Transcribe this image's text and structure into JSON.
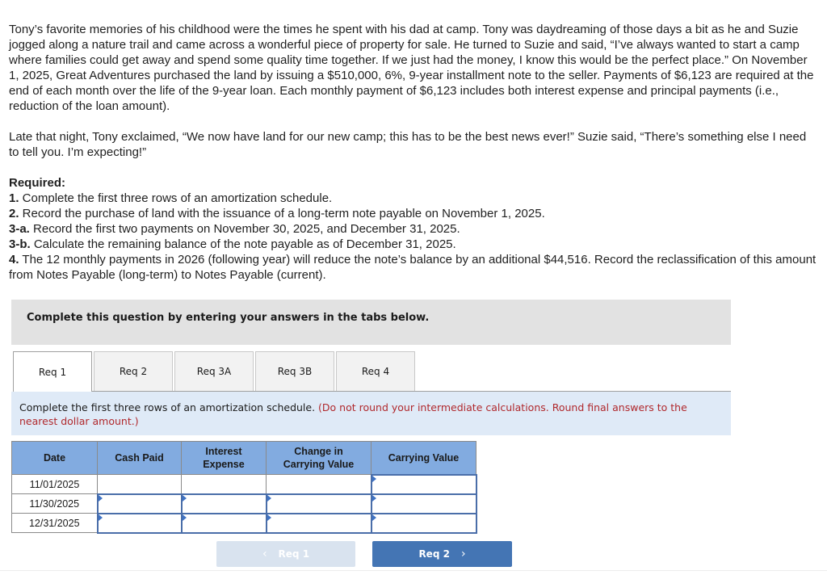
{
  "problem": {
    "paragraph1": "Tony’s favorite memories of his childhood were the times he spent with his dad at camp. Tony was daydreaming of those days a bit as he and Suzie jogged along a nature trail and came across a wonderful piece of property for sale. He turned to Suzie and said, “I’ve always wanted to start a camp where families could get away and spend some quality time together. If we just had the money, I know this would be the perfect place.” On November 1, 2025, Great Adventures purchased the land by issuing a $510,000, 6%, 9-year installment note to the seller. Payments of $6,123 are required at the end of each month over the life of the 9-year loan. Each monthly payment of $6,123 includes both interest expense and principal payments (i.e., reduction of the loan amount).",
    "paragraph2": "Late that night, Tony exclaimed, “We now have land for our new camp; this has to be the best news ever!” Suzie said, “There’s something else I need to tell you. I’m expecting!”",
    "required_title": "Required:",
    "requirements": [
      {
        "num": "1.",
        "text": " Complete the first three rows of an amortization schedule."
      },
      {
        "num": "2.",
        "text": " Record the purchase of land with the issuance of a long-term note payable on November 1, 2025."
      },
      {
        "num": "3-a.",
        "text": " Record the first two payments on November 30, 2025, and December 31, 2025."
      },
      {
        "num": "3-b.",
        "text": " Calculate the remaining balance of the note payable as of December 31, 2025."
      },
      {
        "num": "4.",
        "text": " The 12 monthly payments in 2026 (following year) will reduce the note’s balance by an additional $44,516. Record the reclassification of this amount from Notes Payable (long-term) to Notes Payable (current)."
      }
    ]
  },
  "instructions": "Complete this question by entering your answers in the tabs below.",
  "tabs": [
    {
      "label": "Req 1",
      "active": true
    },
    {
      "label": "Req 2",
      "active": false
    },
    {
      "label": "Req 3A",
      "active": false
    },
    {
      "label": "Req 3B",
      "active": false
    },
    {
      "label": "Req 4",
      "active": false
    }
  ],
  "prompt": {
    "text": "Complete the first three rows of an amortization schedule. ",
    "note": "(Do not round your intermediate calculations. Round final answers to the nearest dollar amount.)"
  },
  "table": {
    "headers": [
      "Date",
      "Cash Paid",
      "Interest Expense",
      "Change in Carrying Value",
      "Carrying Value"
    ],
    "rows": [
      {
        "date": "11/01/2025",
        "cash_paid": "",
        "interest_expense": "",
        "change": "",
        "carrying_value": ""
      },
      {
        "date": "11/30/2025",
        "cash_paid": "",
        "interest_expense": "",
        "change": "",
        "carrying_value": ""
      },
      {
        "date": "12/31/2025",
        "cash_paid": "",
        "interest_expense": "",
        "change": "",
        "carrying_value": ""
      }
    ]
  },
  "nav": {
    "prev_label": "Req 1",
    "next_label": "Req 2",
    "prev_icon": "chevron-left-icon",
    "next_icon": "chevron-right-icon"
  },
  "colors": {
    "table_header": "#82abe0",
    "prompt_bg": "#dfeaf7",
    "note_red": "#b0282c",
    "next_button": "#4475b4",
    "prev_button_disabled": "#d9e3ef"
  }
}
